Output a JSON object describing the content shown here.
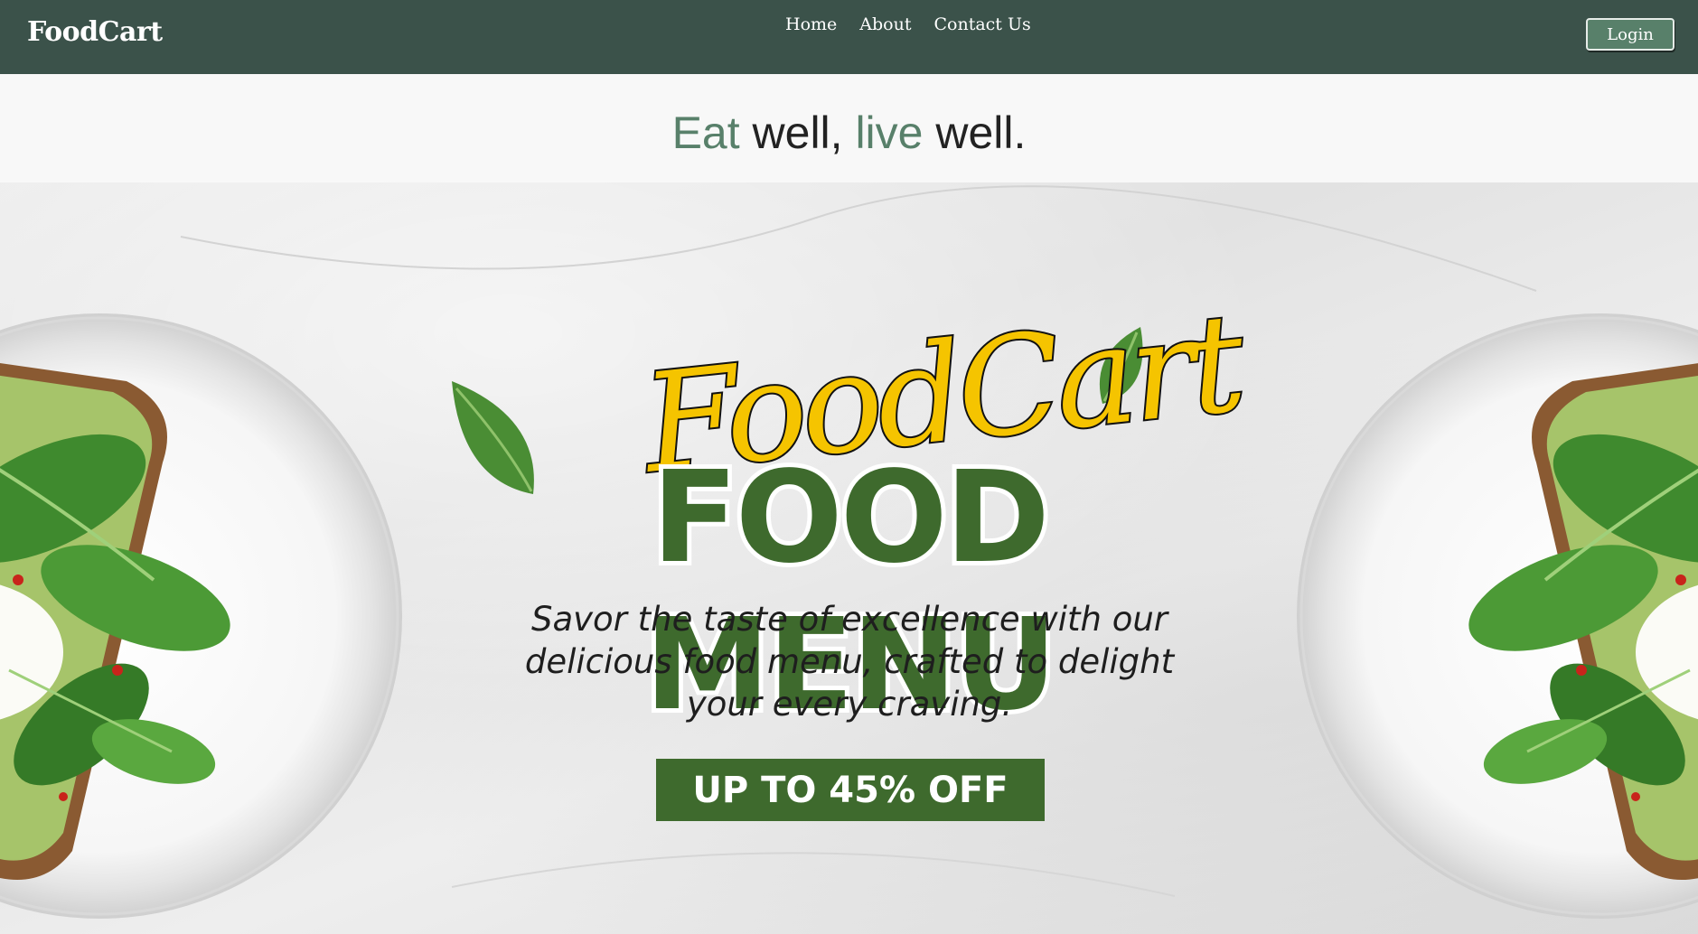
{
  "navbar": {
    "brand": "FoodCart",
    "links": [
      "Home",
      "About",
      "Contact Us"
    ],
    "login_label": "Login",
    "background_color": "#3b524a"
  },
  "tagline": {
    "part1_accent": "Eat",
    "part2": " well, ",
    "part3_accent": "live",
    "part4": " well.",
    "accent_color": "#58806a"
  },
  "hero": {
    "script_logo": "FoodCart",
    "headline": "FOOD MENU",
    "description": "Savor the taste of excellence with our delicious food menu, crafted to delight your every craving.",
    "offer_label": "UP TO 45% OFF",
    "headline_color": "#3e6a2d",
    "script_color": "#f5c400",
    "images": [
      "avocado-toast-plate-left",
      "avocado-toast-plate-right",
      "spinach-leaf"
    ]
  }
}
